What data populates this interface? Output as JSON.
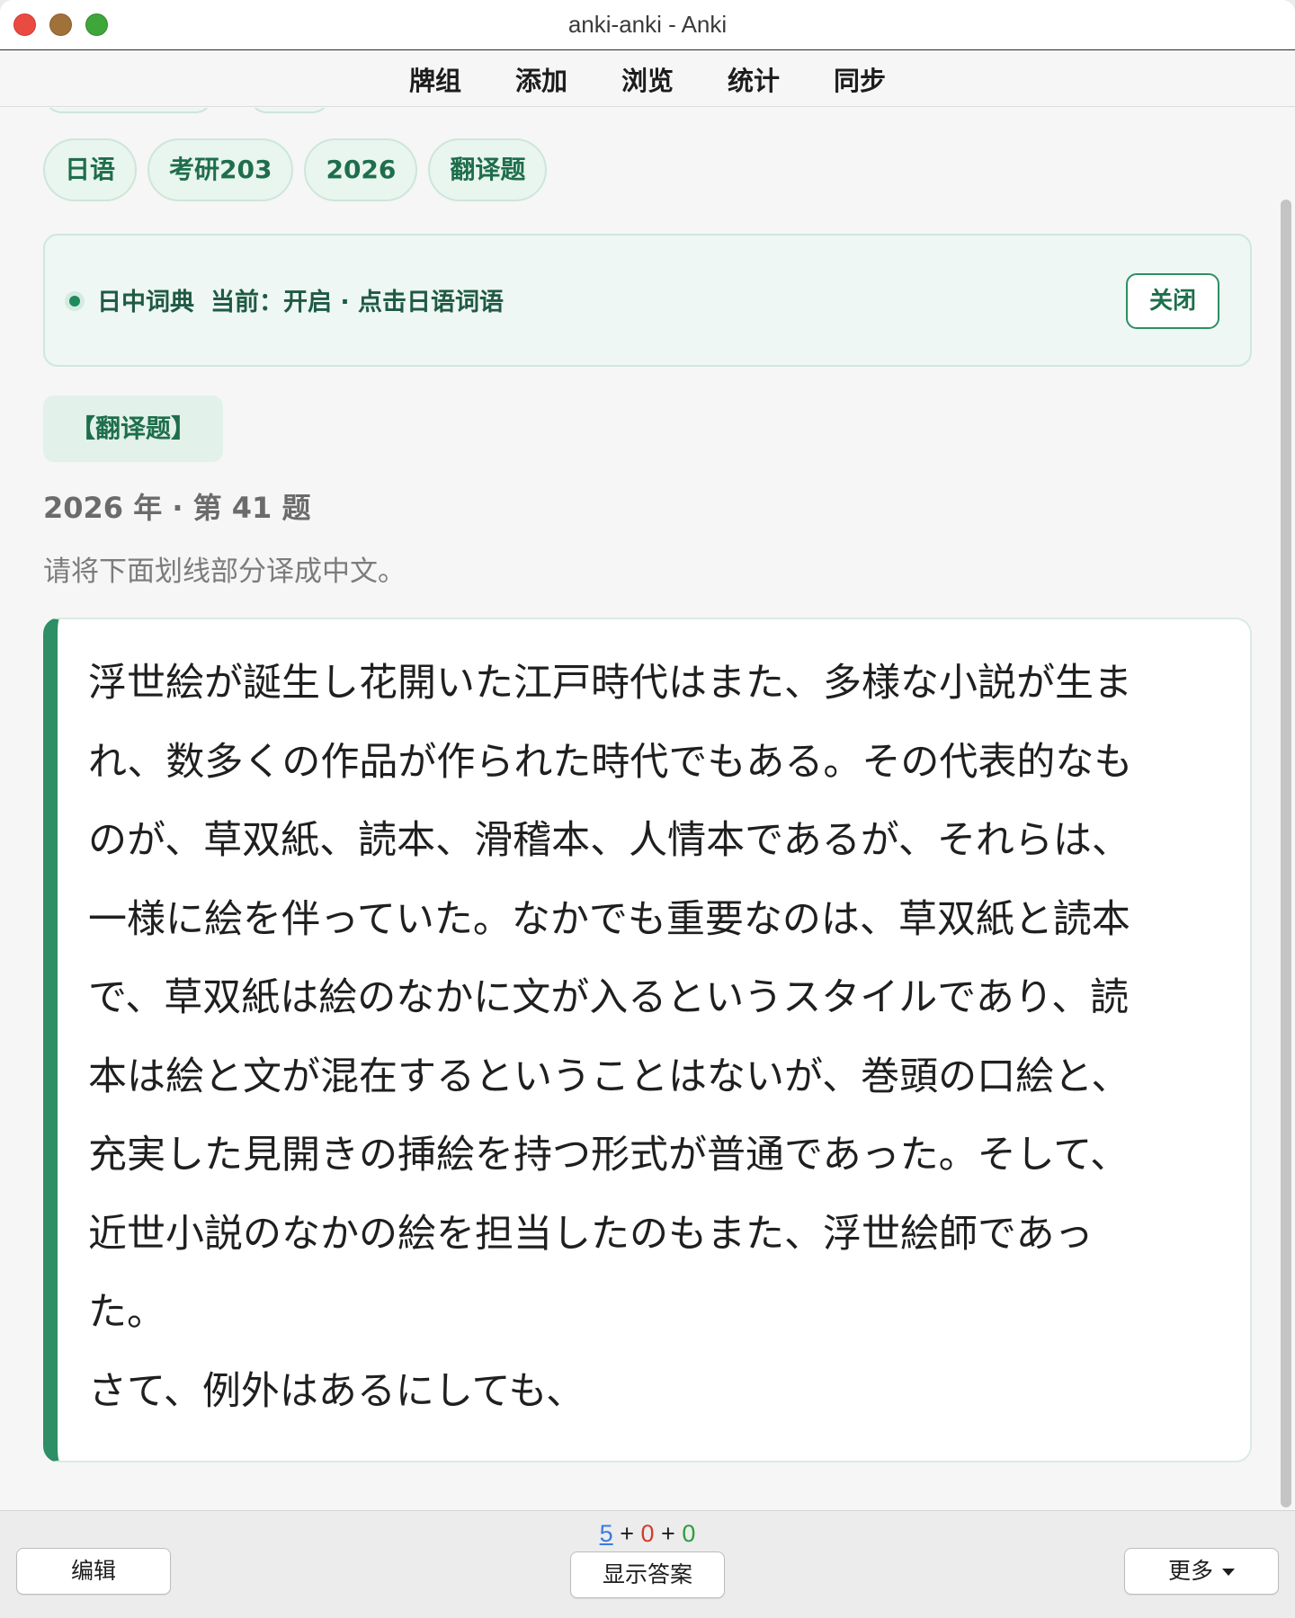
{
  "window": {
    "title": "anki-anki - Anki"
  },
  "toolbar": {
    "items": [
      "牌组",
      "添加",
      "浏览",
      "统计",
      "同步"
    ]
  },
  "tags": [
    "日语",
    "考研203",
    "2026",
    "翻译题"
  ],
  "dictionary": {
    "name": "日中词典",
    "status": "当前：开启 · 点击日语词语",
    "close_label": "关闭"
  },
  "card": {
    "type_label": "【翻译题】",
    "year_line": "2026 年 · 第 41 题",
    "instruction": "请将下面划线部分译成中文。",
    "passage_lines": [
      "浮世絵が誕生し花開いた江戸時代はまた、多様な小説が生ま",
      "れ、数多くの作品が作られた時代でもある。その代表的なも",
      "のが、草双紙、読本、滑稽本、人情本であるが、それらは、",
      "一様に絵を伴っていた。なかでも重要なのは、草双紙と読本",
      "で、草双紙は絵のなかに文が入るというスタイルであり、読",
      "本は絵と文が混在するということはないが、巻頭の口絵と、",
      "充実した見開きの挿絵を持つ形式が普通であった。そして、",
      "近世小説のなかの絵を担当したのもまた、浮世絵師であっ",
      "た。",
      "さて、例外はあるにしても、"
    ]
  },
  "bottom": {
    "counts": {
      "new": "5",
      "learn": "0",
      "review": "0",
      "sep": "+"
    },
    "edit_label": "编辑",
    "show_answer_label": "显示答案",
    "more_label": "更多"
  }
}
